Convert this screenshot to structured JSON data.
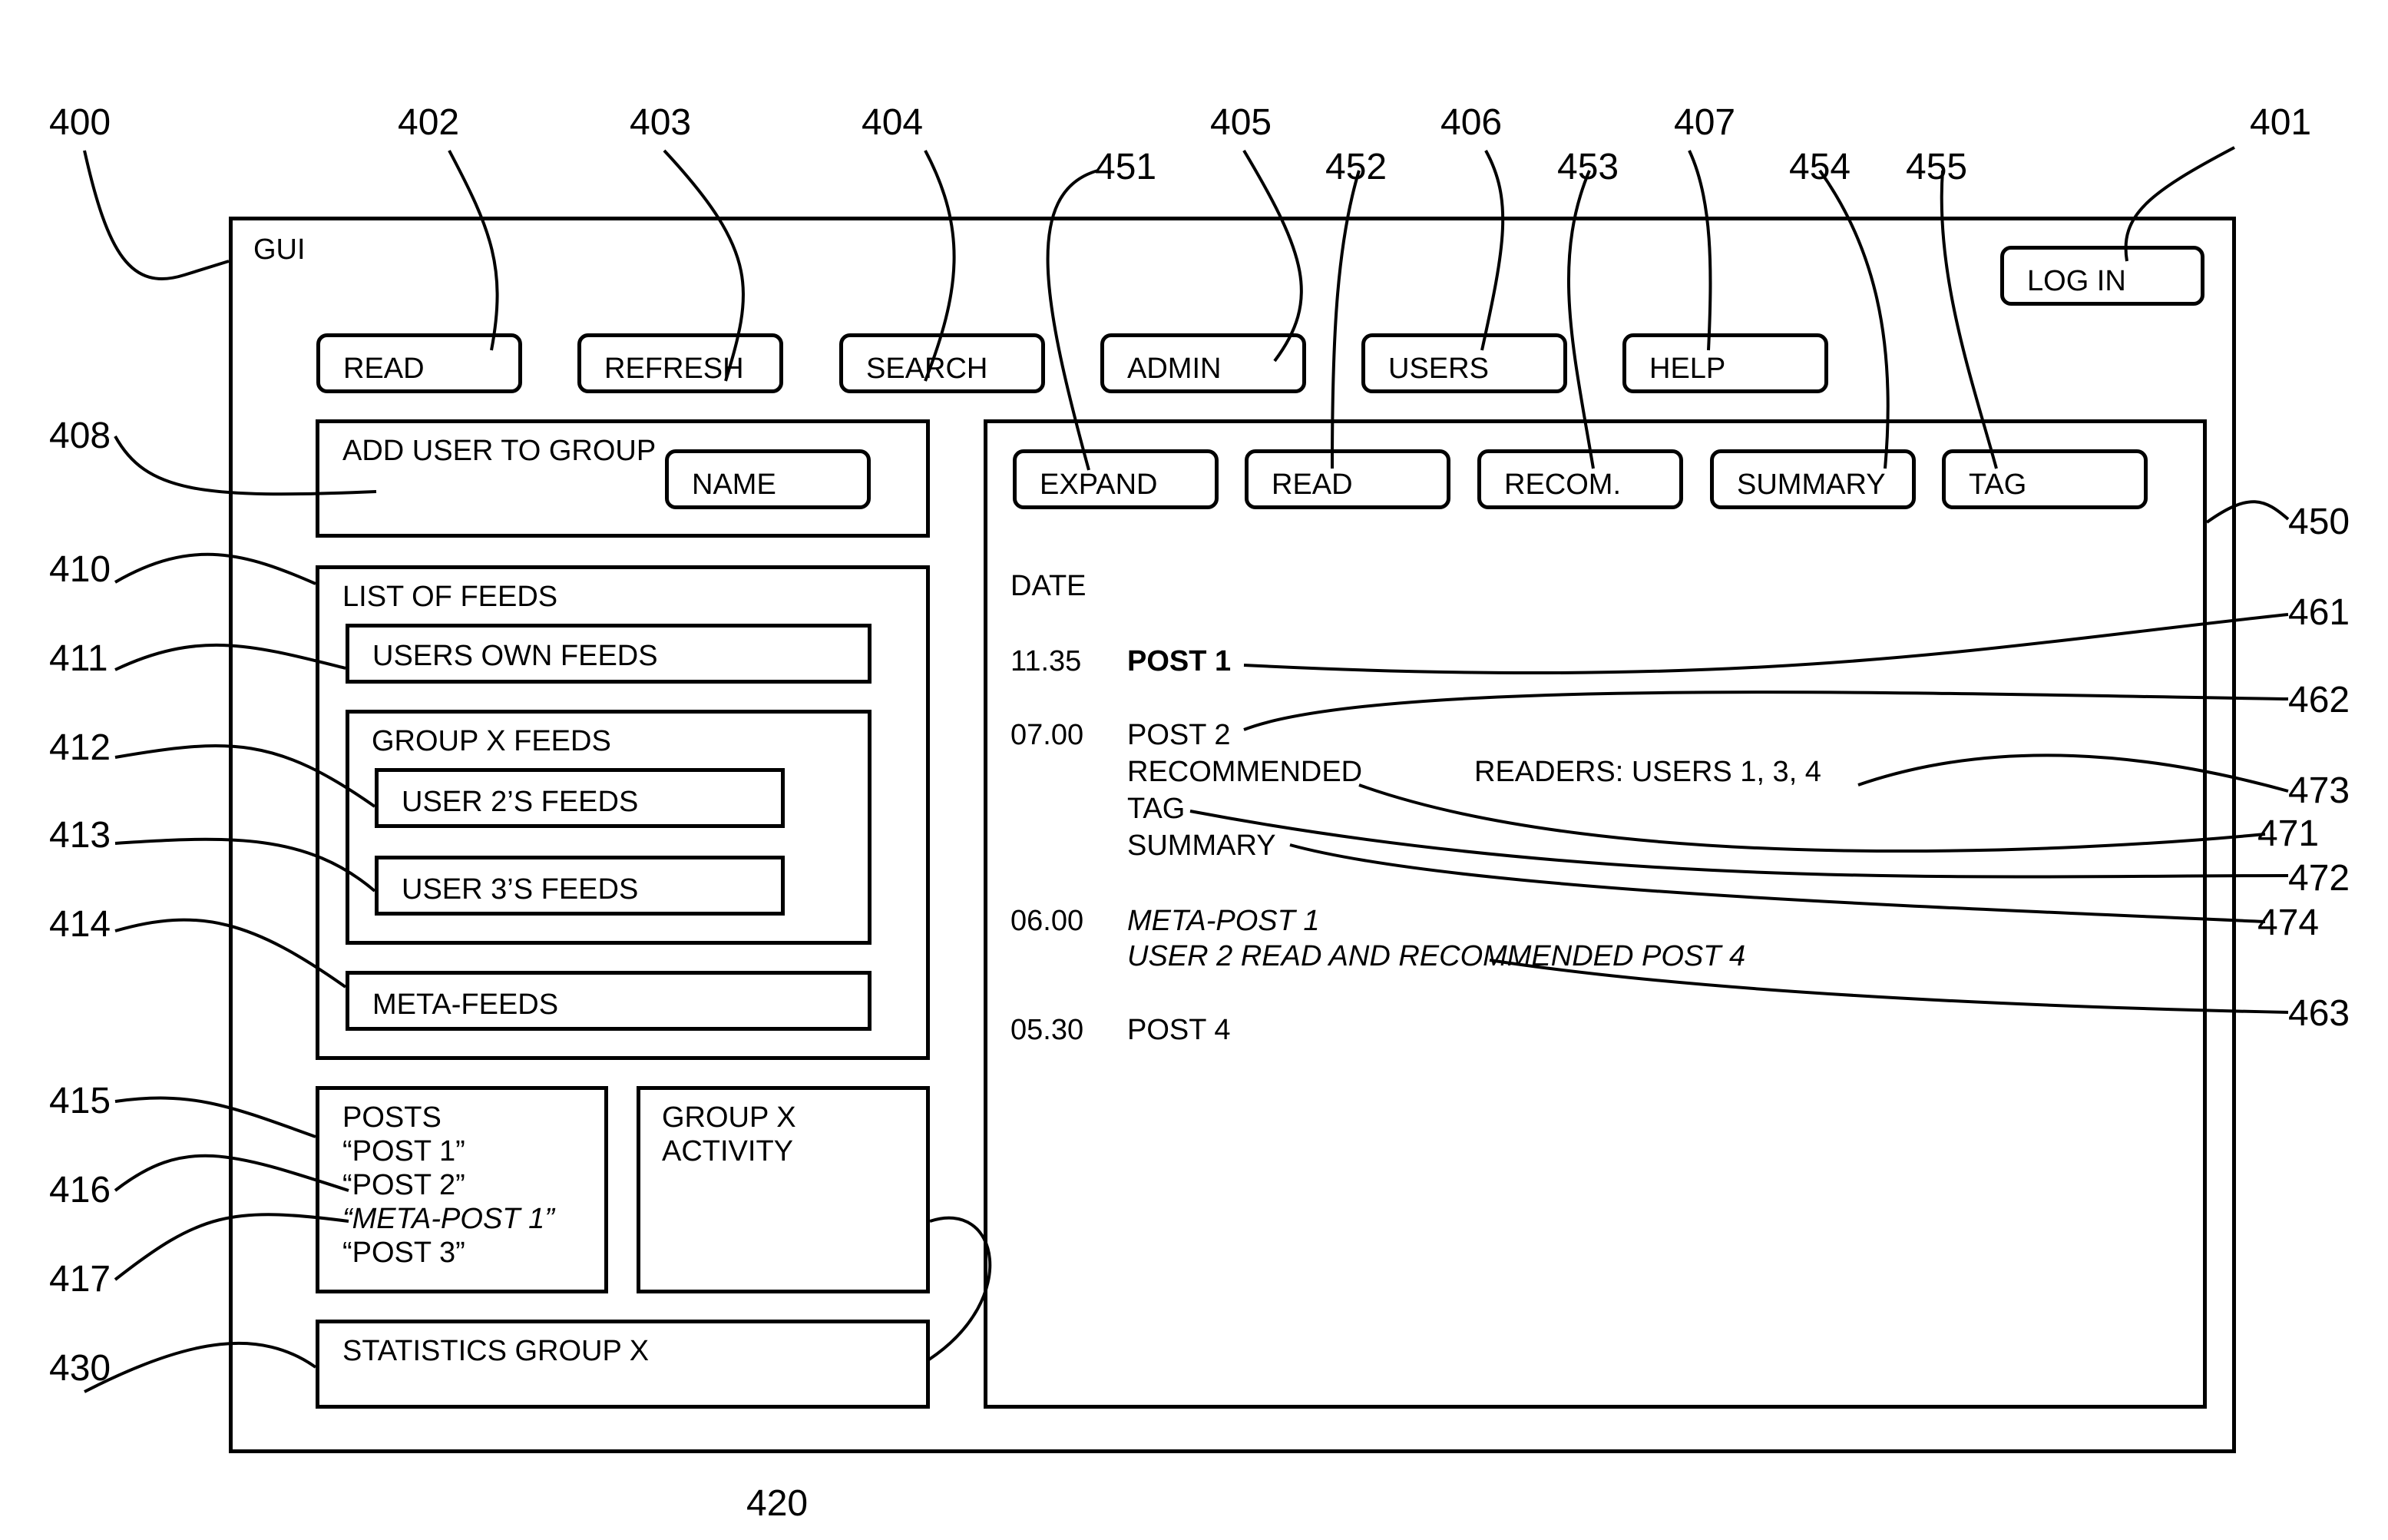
{
  "window": {
    "title": "GUI"
  },
  "login": {
    "label": "LOG IN"
  },
  "toolbar": [
    {
      "label": "READ"
    },
    {
      "label": "REFRESH"
    },
    {
      "label": "SEARCH"
    },
    {
      "label": "ADMIN"
    },
    {
      "label": "USERS"
    },
    {
      "label": "HELP"
    }
  ],
  "add_user": {
    "title": "ADD USER TO GROUP",
    "name_button": "NAME"
  },
  "feeds": {
    "title": "LIST OF FEEDS",
    "own": "USERS OWN FEEDS",
    "group_title": "GROUP X FEEDS",
    "group_items": [
      "USER 2’S FEEDS",
      "USER 3’S FEEDS"
    ],
    "meta": "META-FEEDS"
  },
  "posts_box": {
    "title": "POSTS",
    "items": [
      {
        "text": "“POST 1”",
        "italic": false
      },
      {
        "text": "“POST 2”",
        "italic": false
      },
      {
        "text": "“META-POST 1”",
        "italic": true
      },
      {
        "text": "“POST 3”",
        "italic": false
      }
    ]
  },
  "activity": {
    "line1": "GROUP X",
    "line2": "ACTIVITY"
  },
  "statistics": {
    "title": "STATISTICS GROUP X"
  },
  "reader": {
    "actions": [
      {
        "label": "EXPAND"
      },
      {
        "label": "READ"
      },
      {
        "label": "RECOM."
      },
      {
        "label": "SUMMARY"
      },
      {
        "label": "TAG"
      }
    ],
    "date_header": "DATE",
    "entries": [
      {
        "time": "11.35",
        "title": "POST 1",
        "bold": true
      },
      {
        "time": "07.00",
        "title": "POST 2",
        "sub": [
          "RECOMMENDED",
          "TAG",
          "SUMMARY"
        ],
        "readers": "READERS: USERS 1, 3, 4"
      },
      {
        "time": "06.00",
        "title": "META-POST 1",
        "italic": true,
        "detail": "USER 2 READ AND RECOMMENDED POST 4"
      },
      {
        "time": "05.30",
        "title": "POST 4"
      }
    ]
  },
  "reference_numerals": {
    "r400": "400",
    "r401": "401",
    "r402": "402",
    "r403": "403",
    "r404": "404",
    "r405": "405",
    "r406": "406",
    "r407": "407",
    "r408": "408",
    "r410": "410",
    "r411": "411",
    "r412": "412",
    "r413": "413",
    "r414": "414",
    "r415": "415",
    "r416": "416",
    "r417": "417",
    "r420": "420",
    "r430": "430",
    "r450": "450",
    "r451": "451",
    "r452": "452",
    "r453": "453",
    "r454": "454",
    "r455": "455",
    "r461": "461",
    "r462": "462",
    "r463": "463",
    "r471": "471",
    "r472": "472",
    "r473": "473",
    "r474": "474"
  }
}
